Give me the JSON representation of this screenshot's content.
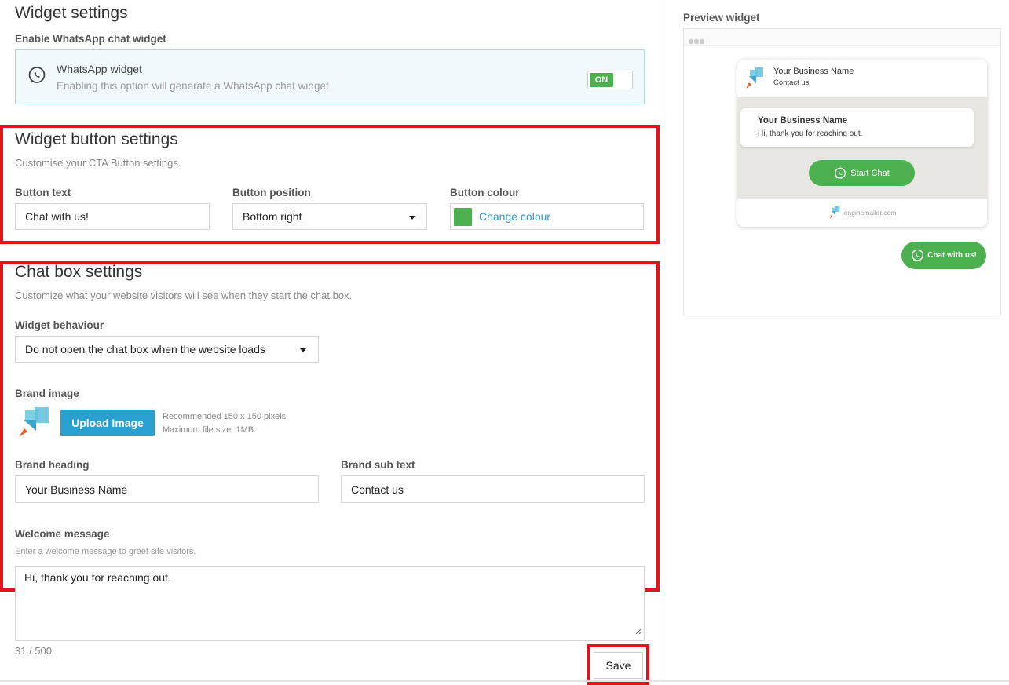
{
  "widget_settings": {
    "title": "Widget settings",
    "enable_label": "Enable WhatsApp chat widget",
    "card_title": "WhatsApp widget",
    "card_desc": "Enabling this option will generate a WhatsApp chat widget",
    "toggle_label": "ON",
    "toggle_on": true
  },
  "button_settings": {
    "title": "Widget button settings",
    "subtitle": "Customise your CTA Button settings",
    "button_text_label": "Button text",
    "button_text_value": "Chat with us!",
    "position_label": "Button position",
    "position_value": "Bottom right",
    "colour_label": "Button colour",
    "colour_action": "Change colour",
    "colour_value": "#4caf50"
  },
  "chatbox_settings": {
    "title": "Chat box settings",
    "subtitle": "Customize what your website visitors will see when they start the chat box.",
    "behaviour_label": "Widget behaviour",
    "behaviour_value": "Do not open the chat box when the website loads",
    "brand_image_label": "Brand image",
    "upload_button": "Upload Image",
    "recommend_text": "Recommended 150 x 150 pixels",
    "max_size_text": "Maximum file size: 1MB",
    "brand_heading_label": "Brand heading",
    "brand_heading_value": "Your Business Name",
    "brand_subtext_label": "Brand sub text",
    "brand_subtext_value": "Contact us",
    "welcome_label": "Welcome message",
    "welcome_hint": "Enter a welcome message to greet site visitors.",
    "welcome_value": "Hi, thank you for reaching out.",
    "char_count": "31 / 500",
    "save_button": "Save"
  },
  "preview": {
    "title": "Preview widget",
    "business_name": "Your Business Name",
    "contact": "Contact us",
    "bubble_name": "Your Business Name",
    "bubble_msg": "Hi, thank you for reaching out.",
    "start_chat": "Start Chat",
    "footer_brand": "enginemailer.com",
    "floating_button": "Chat with us!"
  },
  "colors": {
    "whatsapp_green": "#4caf50",
    "upload_blue": "#2aa0d0",
    "highlight_red": "#e1141e",
    "link_blue": "#2a9bc6"
  }
}
